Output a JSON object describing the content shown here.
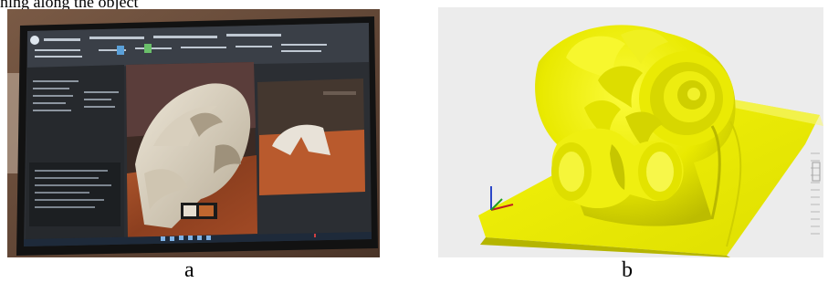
{
  "figure": {
    "panels": [
      {
        "label": "a"
      },
      {
        "label": "b"
      }
    ],
    "top_text": "ning along the object"
  }
}
